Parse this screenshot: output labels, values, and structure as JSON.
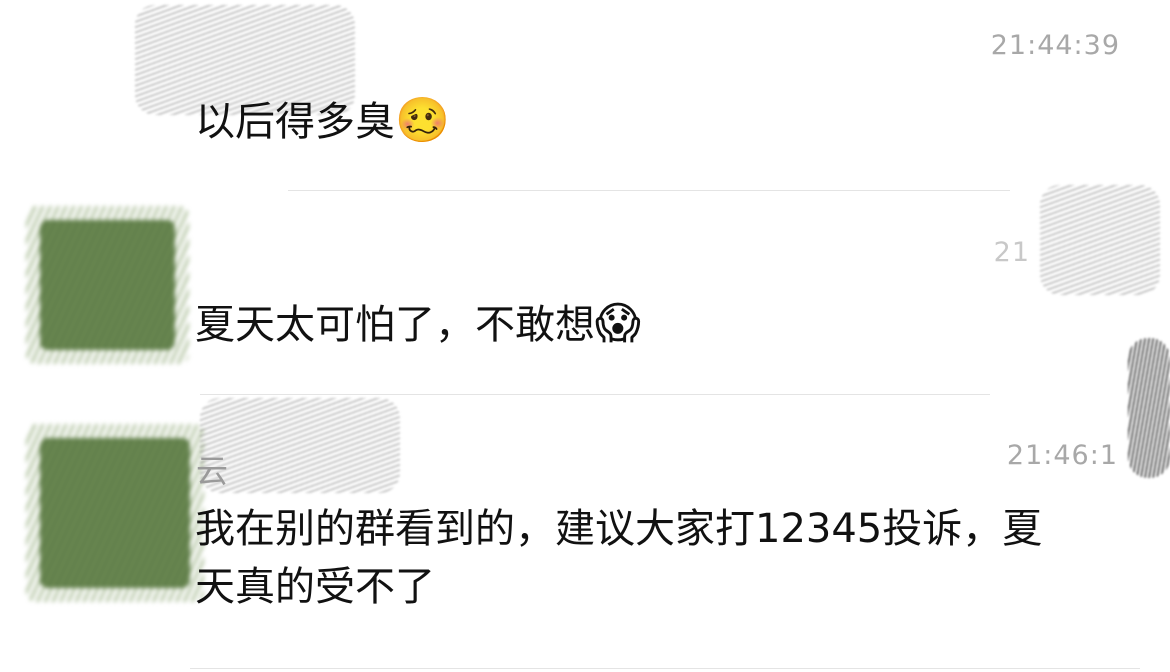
{
  "messages": [
    {
      "time": "21:44:39",
      "sender": "",
      "text": "以后得多臭",
      "emoji": "🥴",
      "emoji_name": "woozy-face-icon"
    },
    {
      "time": "21",
      "sender": "",
      "text": "夏天太可怕了，不敢想",
      "emoji": "😱",
      "emoji_name": "screaming-face-icon"
    },
    {
      "time": "21:46:1",
      "sender": "云",
      "text": "我在别的群看到的，建议大家打12345投诉，夏天真的受不了",
      "emoji": "",
      "emoji_name": ""
    }
  ]
}
